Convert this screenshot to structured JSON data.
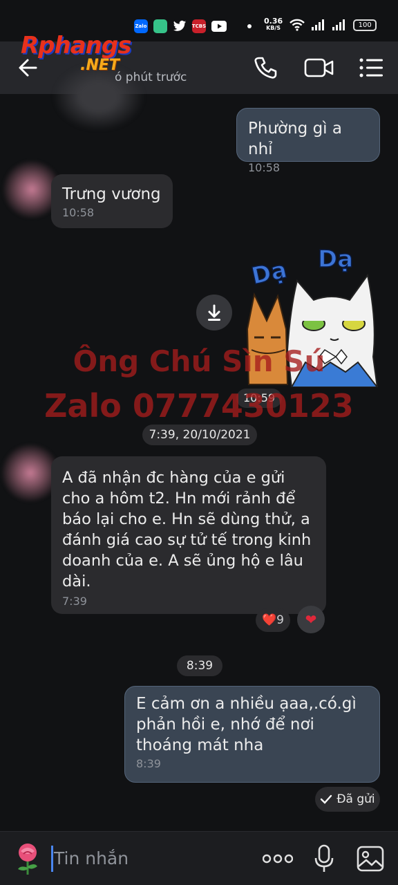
{
  "status_bar": {
    "net_speed_value": "0.36",
    "net_speed_unit": "KB/S",
    "battery": "100",
    "app_icons": [
      "zalo-icon",
      "green-app-icon",
      "twitter-icon",
      "tcbs-icon",
      "youtube-icon"
    ],
    "zalo_label": "Zalo",
    "tcbs_label": "TCBS"
  },
  "header": {
    "logo_main": "Rphangs",
    "logo_sub": ".NET",
    "last_seen": "ó phút trước",
    "icons": [
      "back-arrow-icon",
      "phone-icon",
      "video-call-icon",
      "menu-icon"
    ]
  },
  "watermark": {
    "line1": "Ông Chú Sìn Sú",
    "line2": "Zalo 0777430123"
  },
  "messages": [
    {
      "direction": "out",
      "text": "Phường gì a nhỉ",
      "time": "10:58"
    },
    {
      "direction": "in",
      "text": "Trưng vương",
      "time": "10:58"
    },
    {
      "direction": "in",
      "type": "sticker",
      "sticker_text": [
        "Dạ",
        "Dạ"
      ],
      "time": "10:59"
    },
    {
      "direction": "in",
      "text": "A đã nhận đc hàng của e gửi cho a hôm t2. Hn mới rảnh để báo lại cho e. Hn sẽ dùng thử, a đánh giá cao sự tử tế trong kinh doanh của e. A sẽ ủng hộ e lâu dài.",
      "time": "7:39",
      "reactions": {
        "emoji": "❤️",
        "count": "9"
      }
    },
    {
      "direction": "out",
      "text": "E cảm ơn a nhiều ạaa,.có.gì phản hồi e, nhớ để nơi thoáng mát nha",
      "time": "8:39"
    }
  ],
  "date_separators": [
    "7:39, 20/10/2021",
    "8:39"
  ],
  "sent_status": "Đã gửi",
  "composer": {
    "placeholder": "Tin nhắn",
    "icons": [
      "rose-sticker-icon",
      "more-icon",
      "microphone-icon",
      "image-icon"
    ]
  },
  "colors": {
    "background": "#111214",
    "incoming_bubble": "#2b2b2e",
    "outgoing_bubble": "#3a4553",
    "header": "#26272b",
    "watermark": "#a51c1c"
  }
}
